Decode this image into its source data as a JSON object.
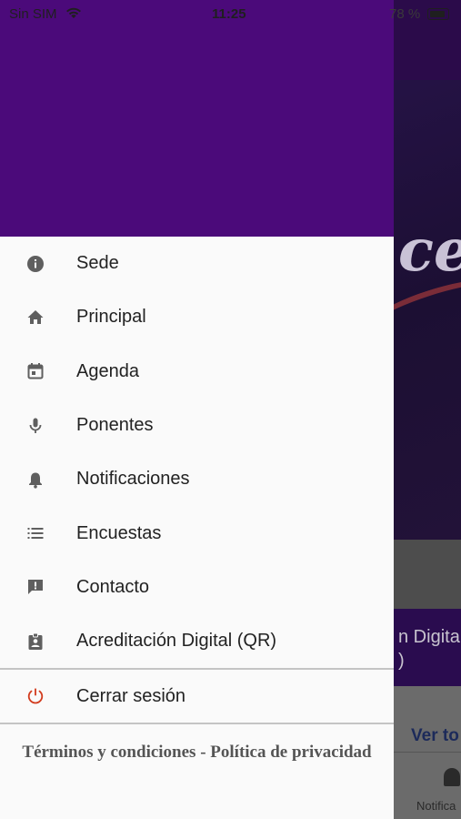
{
  "status_bar": {
    "carrier": "Sin SIM",
    "time": "11:25",
    "battery_pct": "78 %"
  },
  "background": {
    "hero_word": "ce",
    "card_title_line1": "n Digita",
    "card_title_line2": ")",
    "see_all": "Ver to",
    "tab_notifications": "Notifica"
  },
  "drawer": {
    "menu": [
      {
        "label": "Sede",
        "icon": "info-icon"
      },
      {
        "label": "Principal",
        "icon": "home-icon"
      },
      {
        "label": "Agenda",
        "icon": "calendar-icon"
      },
      {
        "label": "Ponentes",
        "icon": "microphone-icon"
      },
      {
        "label": "Notificaciones",
        "icon": "bell-icon"
      },
      {
        "label": "Encuestas",
        "icon": "list-icon"
      },
      {
        "label": "Contacto",
        "icon": "feedback-icon"
      },
      {
        "label": "Acreditación Digital (QR)",
        "icon": "badge-icon"
      }
    ],
    "logout_label": "Cerrar sesión",
    "logout_color": "#d23c1e",
    "header_color": "#4b0a7a",
    "terms_label": "Términos y condiciones",
    "terms_separator": "-",
    "privacy_label": "Política de privacidad"
  }
}
